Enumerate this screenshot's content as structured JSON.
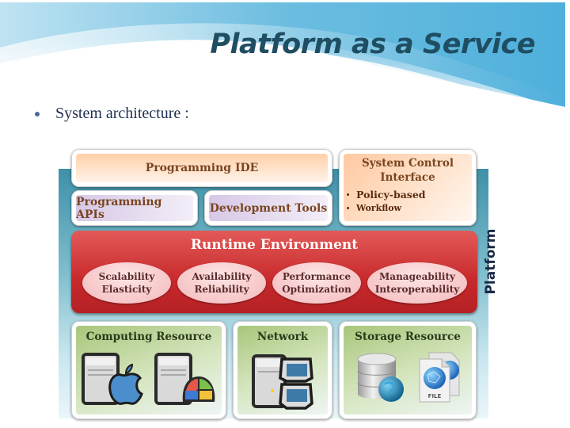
{
  "slide": {
    "title": "Platform as a Service",
    "bullet": "System architecture :"
  },
  "diagram": {
    "side_label": "Platform",
    "programming_ide": "Programming IDE",
    "programming_apis": "Programming APIs",
    "development_tools": "Development Tools",
    "system_control": {
      "title_line1": "System Control",
      "title_line2": "Interface",
      "items": [
        "Policy-based",
        "Workflow"
      ]
    },
    "runtime": {
      "title": "Runtime Environment",
      "ovals": [
        {
          "line1": "Scalability",
          "line2": "Elasticity"
        },
        {
          "line1": "Availability",
          "line2": "Reliability"
        },
        {
          "line1": "Performance",
          "line2": "Optimization"
        },
        {
          "line1": "Manageability",
          "line2": "Interoperability"
        }
      ]
    },
    "resources": [
      {
        "title": "Computing Resource",
        "icons": [
          "server-apple-icon",
          "server-windows-icon"
        ]
      },
      {
        "title": "Network",
        "icons": [
          "server-network-icon"
        ]
      },
      {
        "title": "Storage Resource",
        "icons": [
          "database-globe-icon",
          "file-globe-icon"
        ],
        "file_label": "FILE"
      }
    ],
    "colors": {
      "runtime_red": "#c8292c",
      "title_teal": "#1f4e63",
      "box_text_brown": "#7a4520",
      "resource_green": "#a8c67a",
      "backbar_teal": "#3e90a8"
    }
  }
}
